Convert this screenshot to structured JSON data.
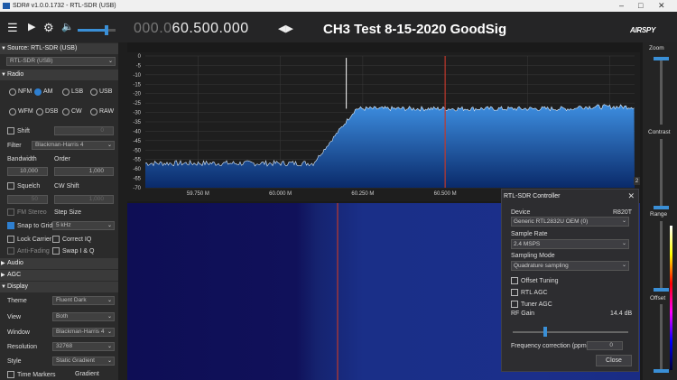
{
  "window": {
    "title": "SDR# v1.0.0.1732 - RTL-SDR (USB)"
  },
  "toolbar": {
    "freq_dim": "000.0",
    "freq_main": "60.500.000",
    "banner": "CH3 Test 8-15-2020  GoodSig",
    "logo": "AIRSPY",
    "menu_icon": "hamburger-icon",
    "play_icon": "play-icon",
    "settings_icon": "gear-icon",
    "volume_icon": "speaker-icon"
  },
  "source": {
    "header": "Source: RTL-SDR (USB)",
    "value": "RTL-SDR (USB)"
  },
  "radio": {
    "header": "Radio",
    "modes": [
      "NFM",
      "AM",
      "LSB",
      "USB",
      "WFM",
      "DSB",
      "CW",
      "RAW"
    ],
    "selected": "AM",
    "shift_label": "Shift",
    "shift_value": "0",
    "filter_label": "Filter",
    "filter_value": "Blackman-Harris 4",
    "bandwidth_label": "Bandwidth",
    "order_label": "Order",
    "bandwidth_value": "10,000",
    "order_value": "1,000",
    "squelch_label": "Squelch",
    "cw_shift_label": "CW Shift",
    "squelch_value": "50",
    "cw_shift_value": "1,000",
    "fm_stereo": "FM Stereo",
    "step_size_label": "Step Size",
    "snap_label": "Snap to Grid",
    "step_value": "5 kHz",
    "lock_carrier": "Lock Carrier",
    "correct_iq": "Correct IQ",
    "anti_fading": "Anti-Fading",
    "swap_iq": "Swap I & Q"
  },
  "audio": {
    "header": "Audio"
  },
  "agc": {
    "header": "AGC"
  },
  "display": {
    "header": "Display",
    "theme_label": "Theme",
    "theme_value": "Fluent Dark",
    "view_label": "View",
    "view_value": "Both",
    "window_label": "Window",
    "window_value": "Blackman-Harris 4",
    "resolution_label": "Resolution",
    "resolution_value": "32768",
    "style_label": "Style",
    "style_value": "Static Gradient",
    "time_markers": "Time Markers",
    "gradient": "Gradient"
  },
  "spectrum": {
    "y_ticks": [
      "0",
      "-5",
      "-10",
      "-15",
      "-20",
      "-25",
      "-30",
      "-35",
      "-40",
      "-45",
      "-50",
      "-55",
      "-60",
      "-65",
      "-70"
    ],
    "x_ticks": [
      "59.750 M",
      "60.000 M",
      "60.250 M",
      "60.500 M",
      "60.750 M",
      "61.000 M"
    ],
    "zoom_badge": "2",
    "noise_floor_db": -57,
    "plateau_db": -28,
    "center_mhz": 60.5,
    "carrier_mhz": 60.2,
    "colors": {
      "fill_top": "#3d8ee0",
      "fill_bottom": "#0a2a6a",
      "carrier": "#ffffff",
      "tuned": "#c0392b"
    }
  },
  "right": {
    "zoom_label": "Zoom",
    "contrast_label": "Contrast",
    "range_label": "Range",
    "offset_label": "Offset"
  },
  "controller": {
    "title": "RTL-SDR Controller",
    "device_label": "Device",
    "tuner": "R820T",
    "device_value": "Generic RTL2832U OEM (0)",
    "sample_rate_label": "Sample Rate",
    "sample_rate_value": "2.4 MSPS",
    "sampling_mode_label": "Sampling Mode",
    "sampling_mode_value": "Quadrature sampling",
    "offset_tuning": "Offset Tuning",
    "rtl_agc": "RTL AGC",
    "tuner_agc": "Tuner AGC",
    "rf_gain_label": "RF Gain",
    "rf_gain_value": "14.4 dB",
    "freq_corr_label": "Frequency correction (ppm)",
    "freq_corr_value": "0",
    "close": "Close"
  }
}
